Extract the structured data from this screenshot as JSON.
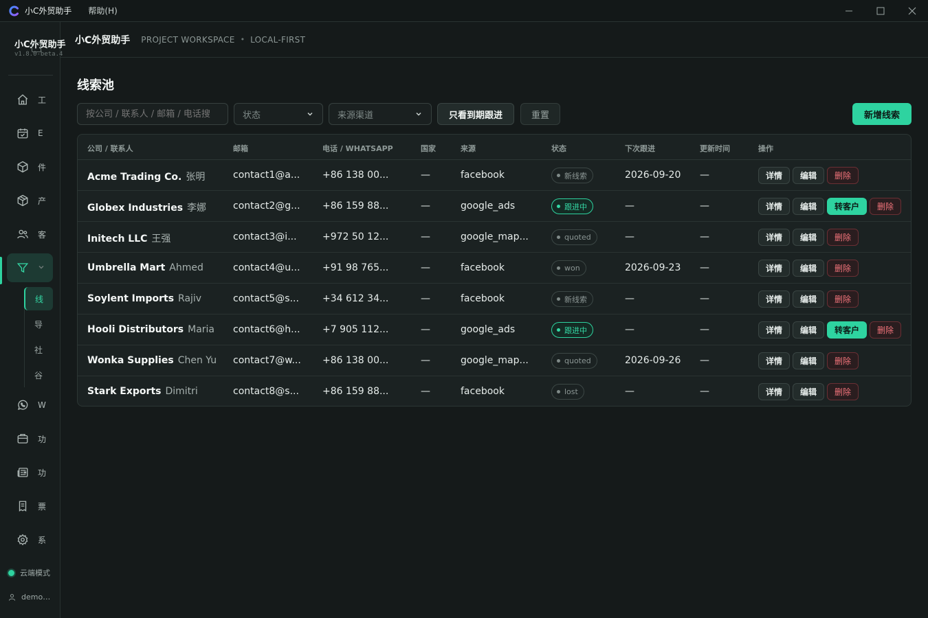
{
  "window": {
    "app_title": "小C外贸助手",
    "menu_help": "帮助(H)",
    "minimize": "─",
    "maximize": "☐",
    "close": "✕"
  },
  "sidebar": {
    "brand": "小C外贸助手",
    "version": "v1.8.0-beta.4",
    "nav": [
      {
        "icon": "home-icon",
        "label": "工"
      },
      {
        "icon": "calendar-icon",
        "label": "E"
      },
      {
        "icon": "cube-icon",
        "label": "件"
      },
      {
        "icon": "box-icon",
        "label": "产"
      },
      {
        "icon": "users-icon",
        "label": "客"
      },
      {
        "icon": "filter-icon",
        "label": ""
      },
      {
        "icon": "whatsapp-icon",
        "label": "W"
      },
      {
        "icon": "briefcase-icon",
        "label": "功"
      },
      {
        "icon": "newspaper-icon",
        "label": "功"
      },
      {
        "icon": "document-icon",
        "label": "票"
      },
      {
        "icon": "settings-icon",
        "label": "系"
      }
    ],
    "subnav": [
      "线",
      "导",
      "社",
      "谷"
    ],
    "status": "云端模式",
    "user": "demo…"
  },
  "header": {
    "title": "小C外贸助手",
    "tag1": "PROJECT WORKSPACE",
    "separator": "•",
    "tag2": "LOCAL-FIRST"
  },
  "page": {
    "title": "线索池",
    "search_placeholder": "按公司 / 联系人 / 邮箱 / 电话搜",
    "status_select": "状态",
    "source_select": "来源渠道",
    "due_button": "只看到期跟进",
    "reset_button": "重置",
    "new_button": "新增线索"
  },
  "table": {
    "headers": [
      "公司 / 联系人",
      "邮箱",
      "电话 / WHATSAPP",
      "国家",
      "来源",
      "状态",
      "下次跟进",
      "更新时间",
      "操作"
    ],
    "actions": {
      "detail": "详情",
      "edit": "编辑",
      "convert": "转客户",
      "delete": "删除"
    },
    "rows": [
      {
        "company": "Acme Trading Co.",
        "contact": "张明",
        "email": "contact1@a...",
        "phone": "+86 138 00...",
        "country": "—",
        "source": "facebook",
        "status": "新线索",
        "status_active": false,
        "next": "2026-09-20",
        "updated": "—",
        "convert": false
      },
      {
        "company": "Globex Industries",
        "contact": "李娜",
        "email": "contact2@g...",
        "phone": "+86 159 88...",
        "country": "—",
        "source": "google_ads",
        "status": "跟进中",
        "status_active": true,
        "next": "—",
        "updated": "—",
        "convert": true
      },
      {
        "company": "Initech LLC",
        "contact": "王强",
        "email": "contact3@i...",
        "phone": "+972 50 12...",
        "country": "—",
        "source": "google_map...",
        "status": "quoted",
        "status_active": false,
        "next": "—",
        "updated": "—",
        "convert": false
      },
      {
        "company": "Umbrella Mart",
        "contact": "Ahmed",
        "email": "contact4@u...",
        "phone": "+91 98 765...",
        "country": "—",
        "source": "facebook",
        "status": "won",
        "status_active": false,
        "next": "2026-09-23",
        "updated": "—",
        "convert": false
      },
      {
        "company": "Soylent Imports",
        "contact": "Rajiv",
        "email": "contact5@s...",
        "phone": "+34 612 34...",
        "country": "—",
        "source": "facebook",
        "status": "新线索",
        "status_active": false,
        "next": "—",
        "updated": "—",
        "convert": false
      },
      {
        "company": "Hooli Distributors",
        "contact": "Maria",
        "email": "contact6@h...",
        "phone": "+7 905 112...",
        "country": "—",
        "source": "google_ads",
        "status": "跟进中",
        "status_active": true,
        "next": "—",
        "updated": "—",
        "convert": true
      },
      {
        "company": "Wonka Supplies",
        "contact": "Chen Yu",
        "email": "contact7@w...",
        "phone": "+86 138 00...",
        "country": "—",
        "source": "google_map...",
        "status": "quoted",
        "status_active": false,
        "next": "2026-09-26",
        "updated": "—",
        "convert": false
      },
      {
        "company": "Stark Exports",
        "contact": "Dimitri",
        "email": "contact8@s...",
        "phone": "+86 159 88...",
        "country": "—",
        "source": "facebook",
        "status": "lost",
        "status_active": false,
        "next": "—",
        "updated": "—",
        "convert": false
      }
    ]
  },
  "colors": {
    "accent": "#2ed3a0",
    "background": "#151a1a",
    "danger": "#f0737a"
  }
}
